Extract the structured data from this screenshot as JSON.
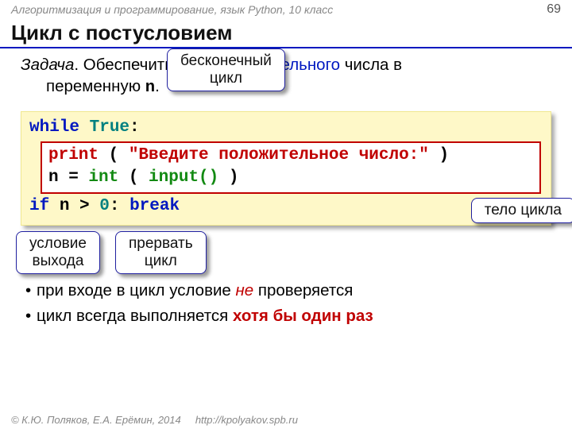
{
  "header": {
    "course": "Алгоритмизация и программирование, язык Python, 10 класс",
    "page": "69"
  },
  "title": "Цикл с постусловием",
  "task": {
    "label": "Задача",
    "textA": ". Обеспечить ввод ",
    "positive": "положительного",
    "textB": " числа в",
    "textC": "переменную ",
    "varname": "n",
    "period": "."
  },
  "code": {
    "line1_while": "while",
    "line1_true": "True",
    "line1_colon": ":",
    "line2_print": "print",
    "line2_paren1": " ( ",
    "line2_str": "\"Введите положительное число:\"",
    "line2_paren2": " )",
    "line3_n": "n",
    "line3_eq": " = ",
    "line3_int": "int",
    "line3_paren1": " ( ",
    "line3_input": "input()",
    "line3_paren2": " )",
    "line4_if": "if",
    "line4_n": " n",
    "line4_gt": " > ",
    "line4_zero": "0",
    "line4_colon": ": ",
    "line4_break": "break"
  },
  "callouts": {
    "infinite": "бесконечный\nцикл",
    "body": "тело цикла",
    "exitcond": "условие\nвыхода",
    "break": "прервать\nцикл"
  },
  "bullets": {
    "b1a": "при входе в цикл условие ",
    "b1b": "не",
    "b1c": " проверяется",
    "b2a": "цикл всегда выполняется ",
    "b2b": "хотя бы один раз"
  },
  "footer": {
    "copyright": "© К.Ю. Поляков, Е.А. Ерёмин, 2014",
    "url": "http://kpolyakov.spb.ru"
  }
}
